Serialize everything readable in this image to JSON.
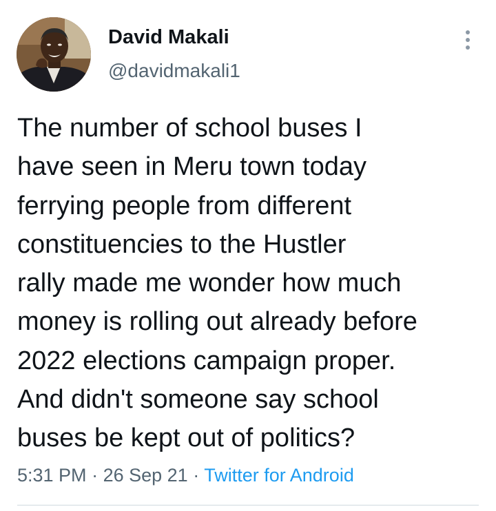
{
  "author": {
    "display_name": "David Makali",
    "handle": "@davidmakali1",
    "avatar_icon": "profile-photo"
  },
  "tweet": {
    "lines": [
      "The number of school buses I",
      "have seen in Meru town today",
      "ferrying people from different",
      "constituencies to the Hustler",
      "rally made me wonder how much",
      "money is rolling out already before",
      "2022 elections campaign proper.",
      "And didn't someone say school",
      "buses be kept out of politics?"
    ]
  },
  "meta": {
    "time": "5:31 PM",
    "separator": "·",
    "date": "26 Sep 21",
    "source": "Twitter for Android"
  },
  "colors": {
    "text": "#0f1419",
    "secondary": "#536471",
    "link": "#1d9bf0"
  }
}
